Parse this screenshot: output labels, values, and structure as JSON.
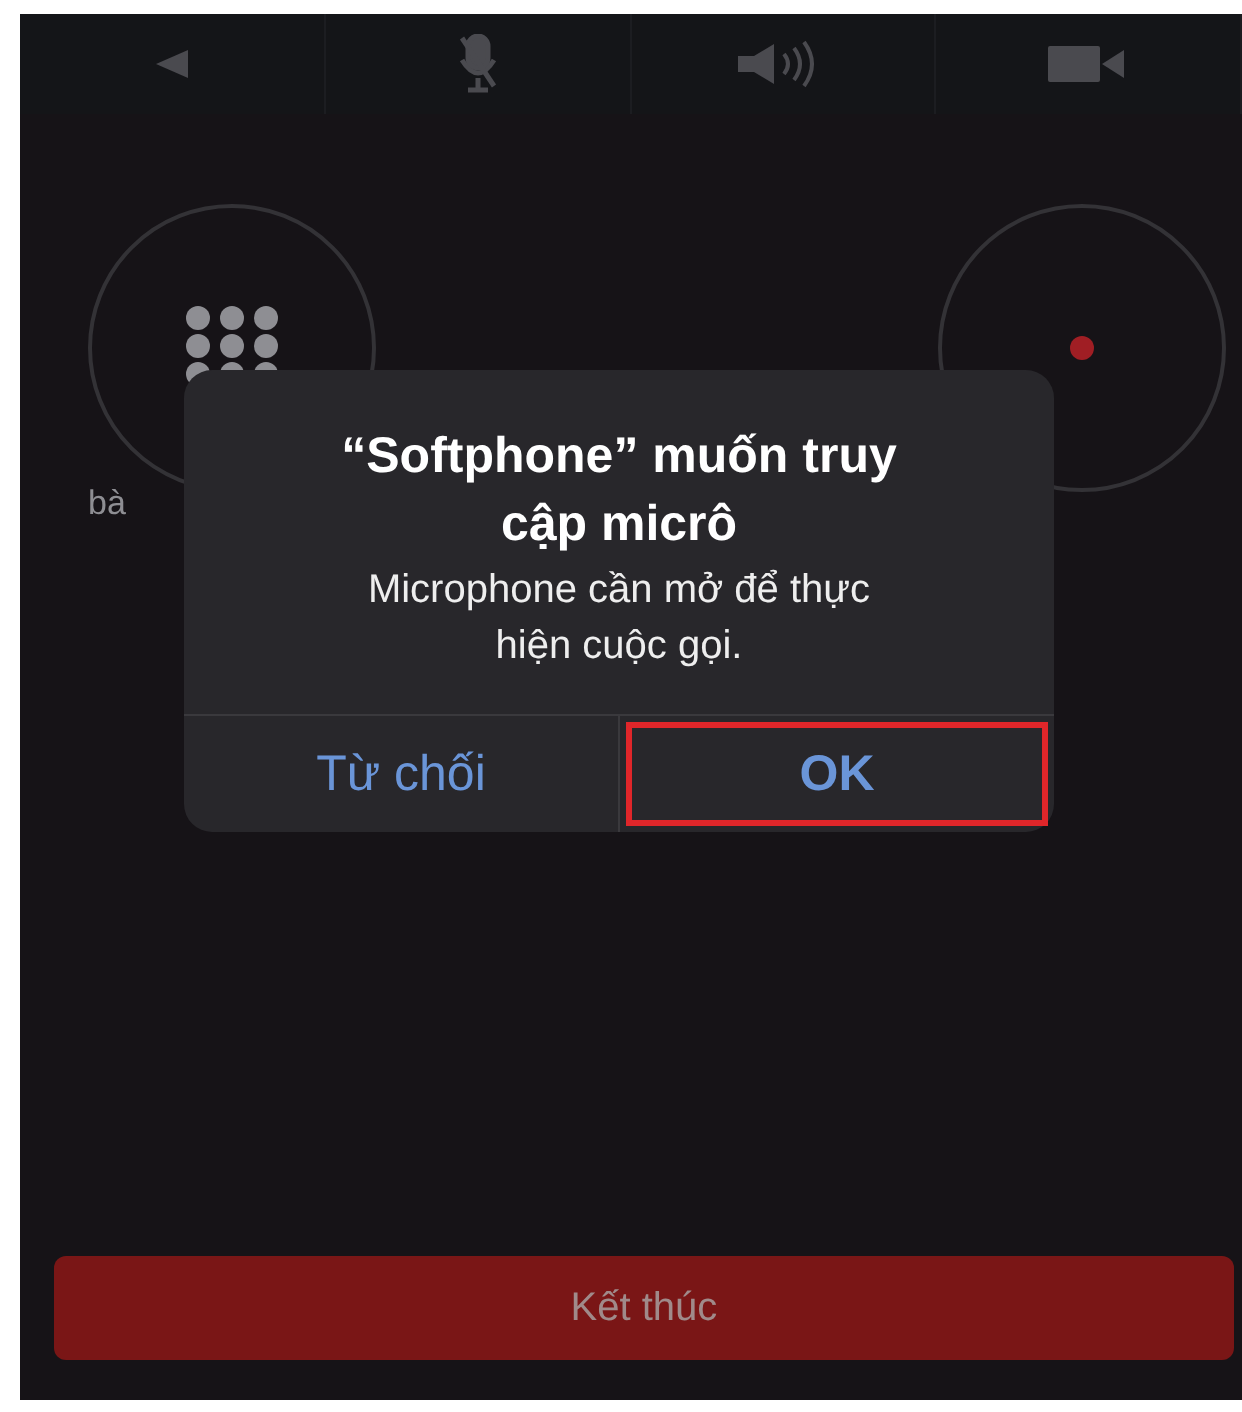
{
  "toolbar": {
    "buttons": [
      {
        "kind": "back"
      },
      {
        "kind": "mic-muted"
      },
      {
        "kind": "speaker"
      },
      {
        "kind": "video"
      }
    ]
  },
  "call_buttons": [
    {
      "kind": "keypad",
      "label": "bà"
    },
    {
      "kind": "record"
    }
  ],
  "dialog": {
    "title": "“Softphone” muốn truy cập micrô",
    "message": "Microphone cần mở để thực hiện cuộc gọi.",
    "buttons": [
      {
        "label": "Từ chối",
        "highlighted": false
      },
      {
        "label": "OK",
        "highlighted": true
      }
    ]
  },
  "end_call": {
    "label": "Kết thúc"
  }
}
